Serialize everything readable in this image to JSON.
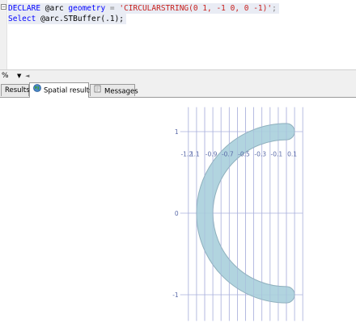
{
  "editor": {
    "line1": {
      "kw1": "DECLARE",
      "var": "@arc",
      "kw2": "geometry",
      "eq": " = ",
      "str": "'CIRCULARSTRING(0 1, -1 0, 0 -1)'",
      "end": ";"
    },
    "line2": {
      "kw": "Select",
      "expr": "@arc.STBuffer(.1);"
    }
  },
  "zoom": {
    "value": "%",
    "dropdown": "▼",
    "scroll": "◄"
  },
  "tabs": [
    {
      "label": "Results",
      "active": false
    },
    {
      "label": "Spatial results",
      "active": true
    },
    {
      "label": "Messages",
      "active": false
    }
  ],
  "spatial": {
    "x_ticks": [
      "-1.2",
      "-1.1",
      "-1",
      "-0.9",
      "-0.8",
      "-0.7",
      "-0.6",
      "-0.5",
      "-0.4",
      "-0.3",
      "-0.2",
      "-0.1",
      "0",
      "0.1",
      "0.2"
    ],
    "x_tick_labels": [
      "-1.2",
      "1.1",
      "-0.9",
      "-0.7",
      "-0.5",
      "-0.3",
      "-0.1",
      "0.1"
    ],
    "y_ticks": [
      "1",
      "0",
      "-1"
    ],
    "shape_fill": "#a9cfdb",
    "shape_stroke": "#8fb0bd",
    "gridline_color": "#aab0dc",
    "geometry": {
      "type": "circularstring-buffer",
      "points": [
        [
          0,
          1
        ],
        [
          -1,
          0
        ],
        [
          0,
          -1
        ]
      ],
      "buffer": 0.1
    }
  }
}
